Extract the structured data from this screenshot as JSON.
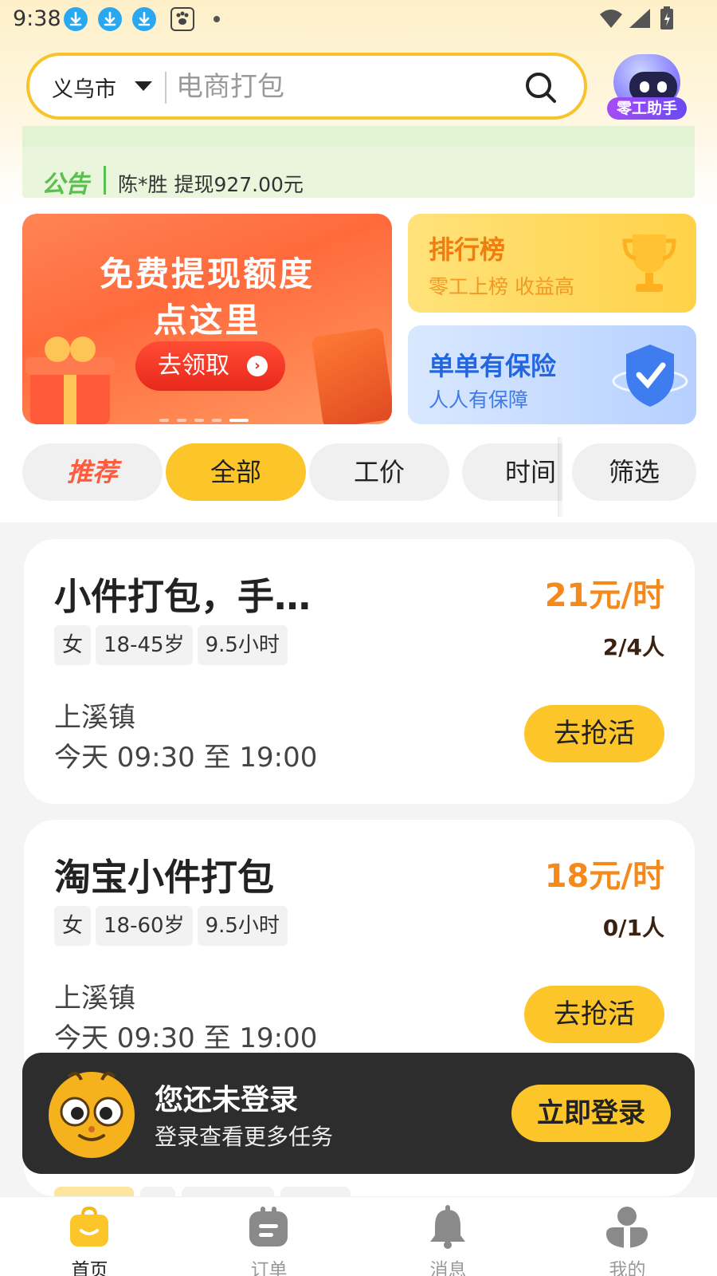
{
  "status_bar": {
    "time": "9:38"
  },
  "search": {
    "city": "义乌市",
    "placeholder": "电商打包"
  },
  "assistant": {
    "label": "零工助手"
  },
  "notice": {
    "tag": "公告",
    "text": "陈*胜 提现927.00元"
  },
  "banner": {
    "title_line1": "免费提现额度",
    "title_line2": "点这里",
    "button": "去领取",
    "arrow": "›"
  },
  "cards": {
    "rank": {
      "title": "排行榜",
      "subtitle": "零工上榜 收益高"
    },
    "insurance": {
      "title": "单单有保险",
      "subtitle": "人人有保障"
    }
  },
  "filters": {
    "recommend": "推荐",
    "all": "全部",
    "wage": "工价",
    "time": "时间",
    "filter": "筛选"
  },
  "jobs": [
    {
      "title": "小件打包，手…",
      "price": "21元/时",
      "tags": [
        "女",
        "18-45岁",
        "9.5小时"
      ],
      "count": "2/4人",
      "place": "上溪镇",
      "time": "今天 09:30 至 19:00",
      "button": "去抢活"
    },
    {
      "title": "淘宝小件打包",
      "price": "18元/时",
      "tags": [
        "女",
        "18-60岁",
        "9.5小时"
      ],
      "count": "0/1人",
      "place": "上溪镇",
      "time": "今天 09:30 至 19:00",
      "button": "去抢活"
    }
  ],
  "login_bar": {
    "title": "您还未登录",
    "subtitle": "登录查看更多任务",
    "button": "立即登录"
  },
  "bottom_nav": {
    "items": [
      {
        "label": "首页",
        "icon": "home-bag-icon",
        "active": true
      },
      {
        "label": "订单",
        "icon": "order-icon",
        "active": false
      },
      {
        "label": "消息",
        "icon": "bell-icon",
        "active": false
      },
      {
        "label": "我的",
        "icon": "person-icon",
        "active": false
      }
    ]
  },
  "colors": {
    "accent_yellow": "#fcc62b",
    "price_orange": "#f5891c",
    "notice_green": "#5bbf4f",
    "login_bar_bg": "#2d2d2d"
  }
}
